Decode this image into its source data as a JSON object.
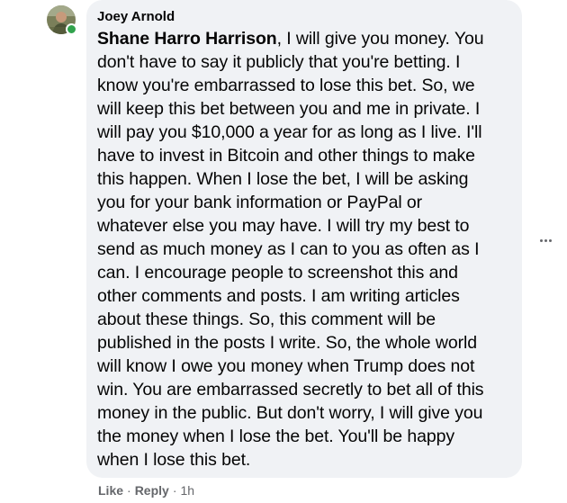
{
  "comment": {
    "author": "Joey Arnold",
    "mention": "Shane Harro Harrison",
    "lines": [
      ", I will give you money. You",
      "don't have to say it publicly that you're betting. I",
      "know you're embarrassed to lose this bet. So, we",
      "will keep this bet between you and me in private. I",
      "will pay you $10,000 a year for as long as I live. I'll",
      "have to invest in Bitcoin and other things to make",
      "this happen. When I lose the bet, I will be asking",
      "you for your bank information or PayPal or",
      "whatever else you may have. I will try my best to",
      "send as much money as I can to you as often as I",
      "can. I encourage people to screenshot this and",
      "other comments and posts. I am writing articles",
      "about these things. So, this comment will be",
      "published in the posts I write. So, the whole world",
      "will know I owe you money when Trump does not",
      "win. You are embarrassed secretly to bet all of this",
      "money in the public. But don't worry, I will give you",
      "the money when I lose the bet. You'll be happy",
      "when I lose this bet."
    ]
  },
  "actions": {
    "like": "Like",
    "separator1": "·",
    "reply": "Reply",
    "separator2": "·",
    "time": "1h"
  },
  "icons": {
    "more": "more-options-icon",
    "avatar": "user-avatar",
    "presence": "online-status-icon"
  },
  "colors": {
    "bubble": "#f0f2f5",
    "text": "#050505",
    "secondary": "#65676b",
    "online": "#31a24c"
  }
}
